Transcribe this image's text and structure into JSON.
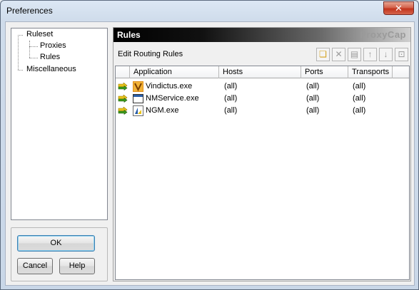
{
  "window": {
    "title": "Preferences",
    "close_glyph": "✕"
  },
  "tree": {
    "items": [
      {
        "label": "Ruleset"
      },
      {
        "label": "Proxies"
      },
      {
        "label": "Rules"
      },
      {
        "label": "Miscellaneous"
      }
    ]
  },
  "buttons": {
    "ok": "OK",
    "cancel": "Cancel",
    "help": "Help"
  },
  "rules": {
    "title": "Rules",
    "brand": "ProxyCap",
    "subtitle": "Edit Routing Rules",
    "toolbar": [
      {
        "icon": "new-rule-icon",
        "glyph": "❏"
      },
      {
        "icon": "delete-icon",
        "glyph": "✕"
      },
      {
        "icon": "properties-icon",
        "glyph": "▤"
      },
      {
        "icon": "move-up-icon",
        "glyph": "↑"
      },
      {
        "icon": "move-down-icon",
        "glyph": "↓"
      },
      {
        "icon": "rule-info-icon",
        "glyph": "⊡"
      }
    ],
    "columns": [
      "Application",
      "Hosts",
      "Ports",
      "Transports"
    ],
    "rows": [
      {
        "application": "Vindictus.exe",
        "hosts": "(all)",
        "ports": "(all)",
        "transports": "(all)",
        "icon": "vindictus-app-icon"
      },
      {
        "application": "NMService.exe",
        "hosts": "(all)",
        "ports": "(all)",
        "transports": "(all)",
        "icon": "window-app-icon"
      },
      {
        "application": "NGM.exe",
        "hosts": "(all)",
        "ports": "(all)",
        "transports": "(all)",
        "icon": "ngm-app-icon"
      }
    ]
  },
  "colors": {
    "arrow_green": "#3c9a1c",
    "arrow_yellow": "#e8c21a",
    "vindictus_orange": "#e0901c"
  }
}
